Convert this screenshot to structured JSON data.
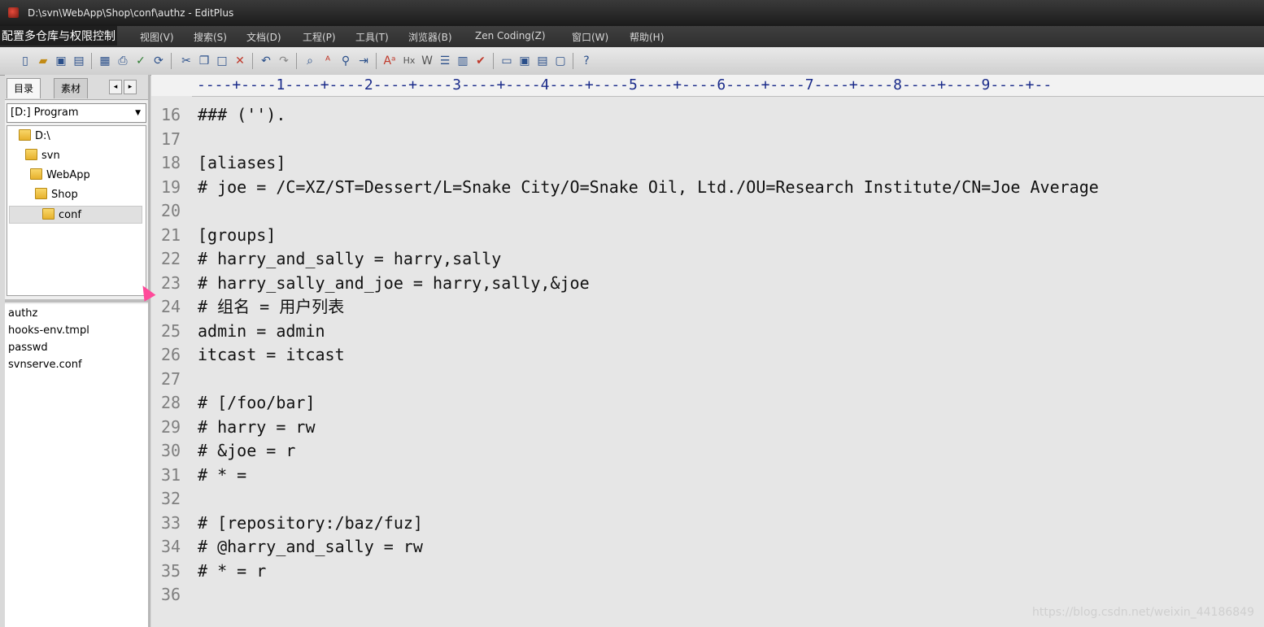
{
  "window": {
    "title": "D:\\svn\\WebApp\\Shop\\conf\\authz - EditPlus"
  },
  "overlay_caption": "配置多仓库与权限控制",
  "menu": [
    "视图(V)",
    "搜索(S)",
    "文档(D)",
    "工程(P)",
    "工具(T)",
    "浏览器(B)",
    "Zen Coding(Z)",
    "窗口(W)",
    "帮助(H)"
  ],
  "sidebar": {
    "tabs": [
      "目录",
      "素材"
    ],
    "drive": "[D:] Program",
    "tree": [
      {
        "label": "D:\\"
      },
      {
        "label": "svn"
      },
      {
        "label": "WebApp"
      },
      {
        "label": "Shop"
      },
      {
        "label": "conf"
      }
    ],
    "files": [
      "authz",
      "hooks-env.tmpl",
      "passwd",
      "svnserve.conf"
    ]
  },
  "ruler": "----+----1----+----2----+----3----+----4----+----5----+----6----+----7----+----8----+----9----+--",
  "lines": [
    {
      "n": "16",
      "text": "### ('')."
    },
    {
      "n": "17",
      "text": ""
    },
    {
      "n": "18",
      "text": "[aliases]"
    },
    {
      "n": "19",
      "text": "# joe = /C=XZ/ST=Dessert/L=Snake City/O=Snake Oil, Ltd./OU=Research Institute/CN=Joe Average"
    },
    {
      "n": "20",
      "text": ""
    },
    {
      "n": "21",
      "text": "[groups]"
    },
    {
      "n": "22",
      "text": "# harry_and_sally = harry,sally"
    },
    {
      "n": "23",
      "text": "# harry_sally_and_joe = harry,sally,&joe"
    },
    {
      "n": "24",
      "text": "# 组名 = 用户列表"
    },
    {
      "n": "25",
      "text": "admin = admin"
    },
    {
      "n": "26",
      "text": "itcast = itcast"
    },
    {
      "n": "27",
      "text": ""
    },
    {
      "n": "28",
      "text": "# [/foo/bar]"
    },
    {
      "n": "29",
      "text": "# harry = rw"
    },
    {
      "n": "30",
      "text": "# &joe = r"
    },
    {
      "n": "31",
      "text": "# * ="
    },
    {
      "n": "32",
      "text": ""
    },
    {
      "n": "33",
      "text": "# [repository:/baz/fuz]"
    },
    {
      "n": "34",
      "text": "# @harry_and_sally = rw"
    },
    {
      "n": "35",
      "text": "# * = r"
    },
    {
      "n": "36",
      "text": ""
    }
  ],
  "watermark": "https://blog.csdn.net/weixin_44186849"
}
